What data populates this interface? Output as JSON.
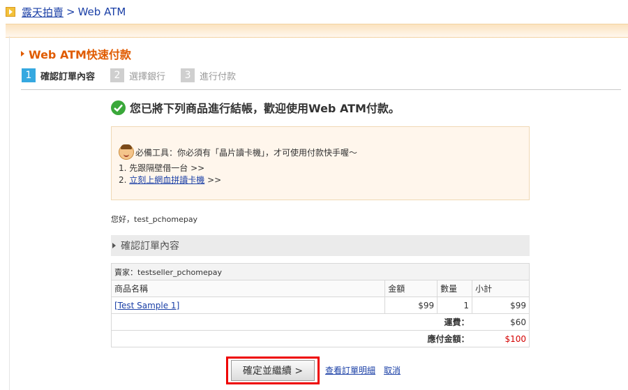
{
  "breadcrumb": {
    "site": "露天拍賣",
    "separator": ">",
    "current": "Web ATM"
  },
  "page_title": "Web ATM快速付款",
  "steps": [
    {
      "num": "1",
      "label": "確認訂單內容",
      "active": true
    },
    {
      "num": "2",
      "label": "選擇銀行",
      "active": false
    },
    {
      "num": "3",
      "label": "進行付款",
      "active": false
    }
  ],
  "welcome": "您已將下列商品進行結帳，歡迎使用Web ATM付款。",
  "notice": {
    "line1": "必備工具：你必須有「晶片讀卡機」，才可使用付款快手喔～",
    "line2_prefix": "1. 先跟隔壁借一台 >>",
    "line3_prefix": "2. ",
    "line3_link": "立刻上網血拼讀卡機",
    "line3_suffix": " >>"
  },
  "greeting": "您好，test_pchomepay",
  "section_title": "確認訂單內容",
  "order": {
    "seller": "賣家：testseller_pchomepay",
    "headers": [
      "商品名稱",
      "金額",
      "數量",
      "小計"
    ],
    "item": {
      "name": "[Test Sample 1]",
      "price": "$99",
      "qty": "1",
      "subtotal": "$99"
    },
    "shipping_label": "運費：",
    "shipping_value": "$60",
    "total_label": "應付金額：",
    "total_value": "$100"
  },
  "actions": {
    "confirm": "確定並繼續 >",
    "view_details": "查看訂單明細",
    "cancel": "取消"
  },
  "colors": {
    "accent": "#e05b00",
    "link": "#1a3fa6",
    "step_active": "#35a8e0",
    "highlight": "#e00000"
  }
}
